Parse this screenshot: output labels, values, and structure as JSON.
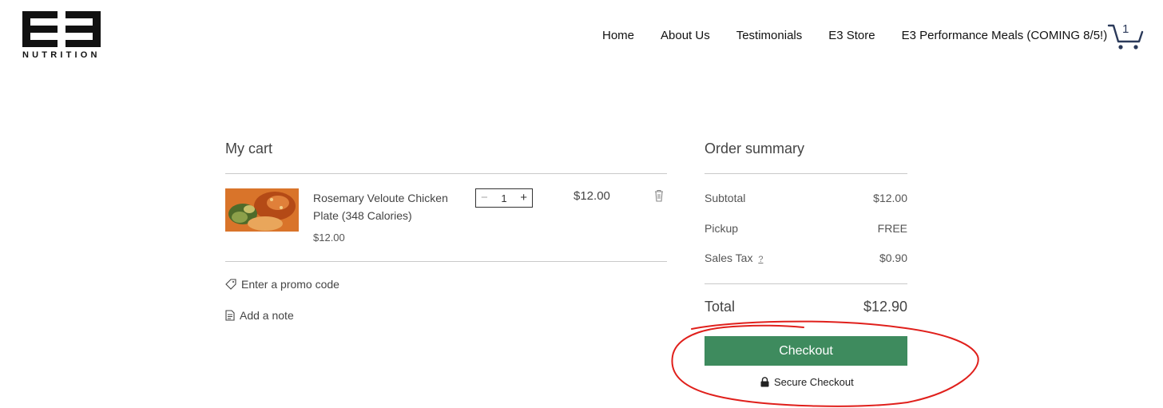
{
  "brand": {
    "logo_text": "NUTRITION"
  },
  "nav": {
    "items": [
      {
        "label": "Home"
      },
      {
        "label": "About Us"
      },
      {
        "label": "Testimonials"
      },
      {
        "label": "E3 Store"
      },
      {
        "label": "E3 Performance Meals (COMING 8/5!)"
      }
    ],
    "cart_count": "1",
    "cart_icon": "shopping-cart-icon"
  },
  "cart": {
    "title": "My cart",
    "item": {
      "name": "Rosemary Veloute Chicken Plate (348 Calories)",
      "unit_price": "$12.00",
      "quantity": "1",
      "line_total": "$12.00"
    },
    "promo_label": "Enter a promo code",
    "note_label": "Add a note"
  },
  "summary": {
    "title": "Order summary",
    "subtotal_label": "Subtotal",
    "subtotal_value": "$12.00",
    "pickup_label": "Pickup",
    "pickup_value": "FREE",
    "tax_label": "Sales Tax",
    "tax_help": "?",
    "tax_value": "$0.90",
    "total_label": "Total",
    "total_value": "$12.90",
    "checkout_label": "Checkout",
    "secure_label": "Secure Checkout"
  },
  "colors": {
    "checkout_button": "#3e8b5e",
    "annotation": "#e0201c"
  }
}
